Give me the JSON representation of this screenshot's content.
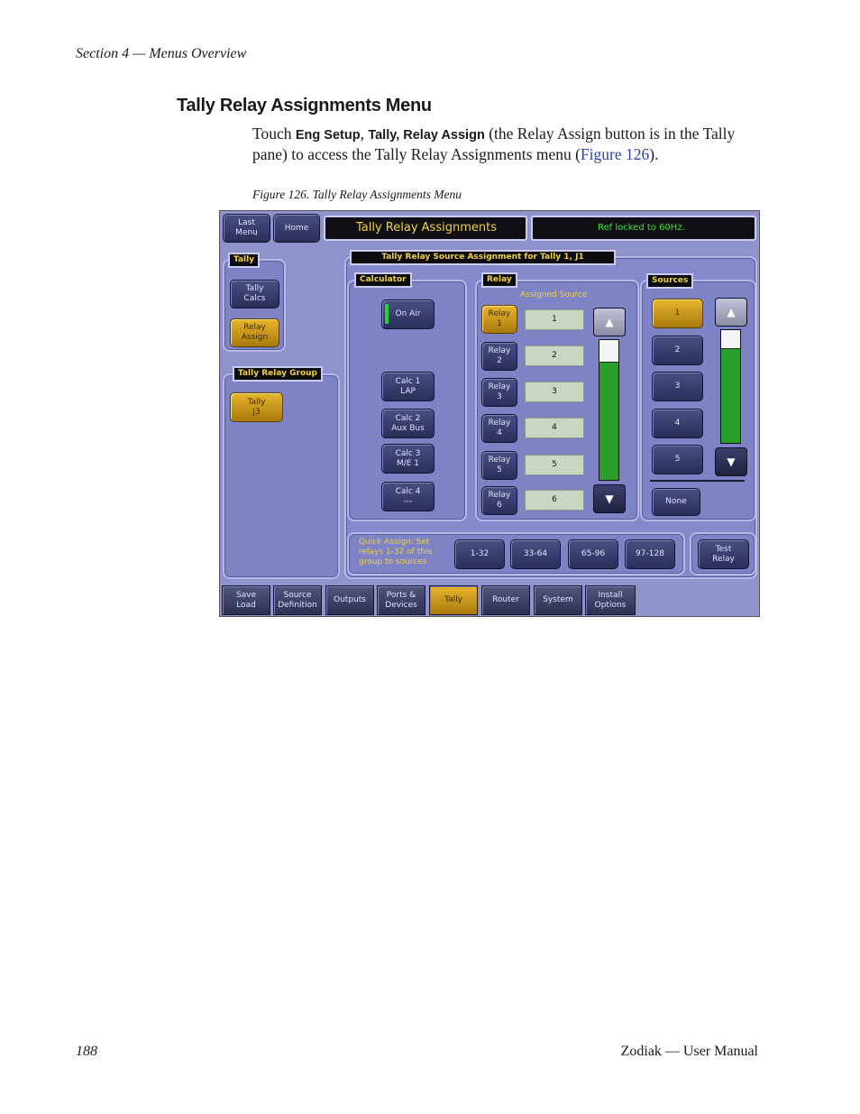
{
  "page": {
    "header": "Section 4 — Menus Overview",
    "heading": "Tally Relay Assignments Menu",
    "para": {
      "t1": "Touch ",
      "b1": "Eng Setup",
      "t2": ", ",
      "b2": "Tally, Relay Assign",
      "t3": " (the Relay Assign button is in the Tally pane) to access the Tally Relay Assignments menu (",
      "link": "Figure 126",
      "t4": ")."
    },
    "caption": "Figure 126.  Tally Relay Assignments Menu",
    "footer_left": "188",
    "footer_right": "Zodiak — User Manual"
  },
  "ui": {
    "last_menu": "Last\nMenu",
    "home": "Home",
    "menu_title": "Tally Relay Assignments",
    "status": "Ref locked to 60Hz.",
    "tally_pane_title": "Tally",
    "tally_calcs": "Tally\nCalcs",
    "relay_assign": "Relay\nAssign",
    "group_pane_title": "Tally Relay Group",
    "tally_j3": "Tally\nJ3",
    "source_assign_title": "Tally Relay Source Assignment for Tally 1, J1",
    "calculator_title": "Calculator",
    "on_air": "On Air",
    "calc1": "Calc 1\nLAP",
    "calc2": "Calc 2\nAux Bus",
    "calc3": "Calc 3\nM/E 1",
    "calc4": "Calc 4\n---",
    "relay_title": "Relay",
    "assigned_source": "Assigned Source",
    "relays": [
      {
        "label": "Relay\n1",
        "value": "1"
      },
      {
        "label": "Relay\n2",
        "value": "2"
      },
      {
        "label": "Relay\n3",
        "value": "3"
      },
      {
        "label": "Relay\n4",
        "value": "4"
      },
      {
        "label": "Relay\n5",
        "value": "5"
      },
      {
        "label": "Relay\n6",
        "value": "6"
      }
    ],
    "sources_title": "Sources",
    "sources": [
      "1",
      "2",
      "3",
      "4",
      "5"
    ],
    "none": "None",
    "quick_assign": "Quick Assign:  Set\nrelays 1-32 of this\ngroup to sources",
    "quick_buttons": [
      "1-32",
      "33-64",
      "65-96",
      "97-128"
    ],
    "test_relay": "Test\nRelay",
    "tabs": [
      "Save\nLoad",
      "Source\nDefinition",
      "Outputs",
      "Ports &\nDevices",
      "Tally",
      "Router",
      "System",
      "Install\nOptions"
    ]
  }
}
